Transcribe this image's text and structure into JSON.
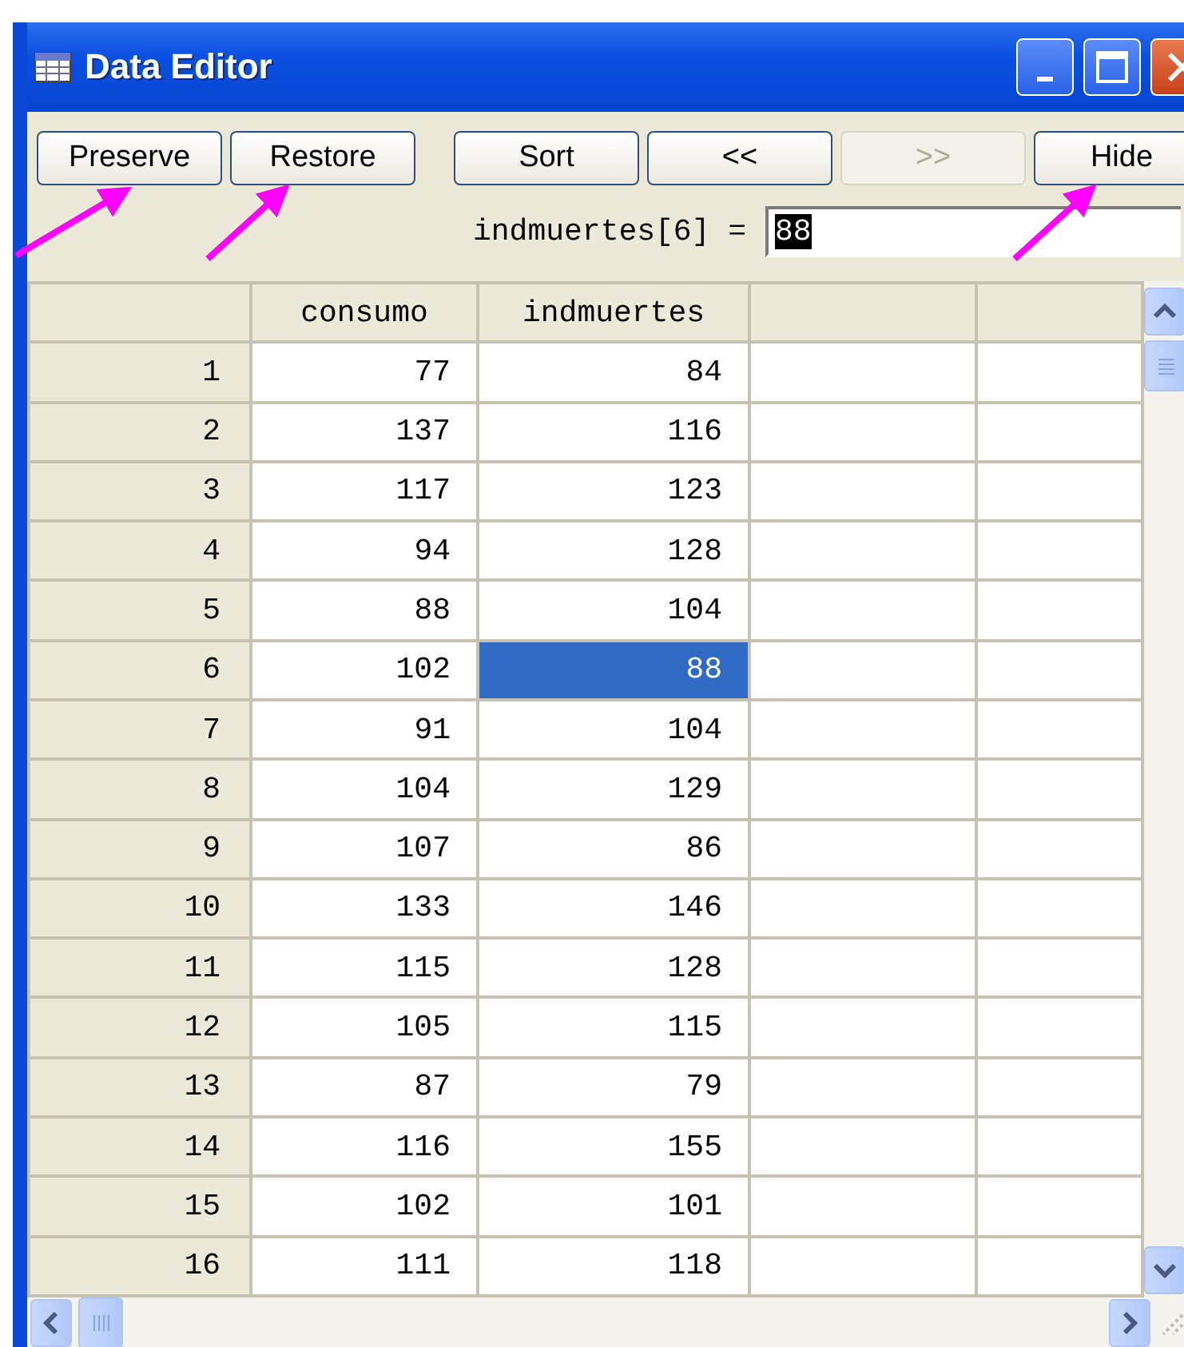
{
  "window": {
    "title": "Data Editor"
  },
  "toolbar": {
    "buttons": [
      {
        "label": "Preserve",
        "disabled": false
      },
      {
        "label": "Restore",
        "disabled": false
      },
      {
        "label": "Sort",
        "disabled": false
      },
      {
        "label": "<<",
        "disabled": false
      },
      {
        "label": ">>",
        "disabled": true
      },
      {
        "label": "Hide",
        "disabled": false
      }
    ]
  },
  "formula": {
    "label": "indmuertes[6] =",
    "value": "88"
  },
  "table": {
    "columns": [
      "consumo",
      "indmuertes"
    ],
    "rows": [
      {
        "number": "1",
        "cells": [
          {
            "text": "77",
            "selected": false
          },
          {
            "text": "84",
            "selected": false
          }
        ]
      },
      {
        "number": "2",
        "cells": [
          {
            "text": "137",
            "selected": false
          },
          {
            "text": "116",
            "selected": false
          }
        ]
      },
      {
        "number": "3",
        "cells": [
          {
            "text": "117",
            "selected": false
          },
          {
            "text": "123",
            "selected": false
          }
        ]
      },
      {
        "number": "4",
        "cells": [
          {
            "text": "94",
            "selected": false
          },
          {
            "text": "128",
            "selected": false
          }
        ]
      },
      {
        "number": "5",
        "cells": [
          {
            "text": "88",
            "selected": false
          },
          {
            "text": "104",
            "selected": false
          }
        ]
      },
      {
        "number": "6",
        "cells": [
          {
            "text": "102",
            "selected": false
          },
          {
            "text": "88",
            "selected": true
          }
        ]
      },
      {
        "number": "7",
        "cells": [
          {
            "text": "91",
            "selected": false
          },
          {
            "text": "104",
            "selected": false
          }
        ]
      },
      {
        "number": "8",
        "cells": [
          {
            "text": "104",
            "selected": false
          },
          {
            "text": "129",
            "selected": false
          }
        ]
      },
      {
        "number": "9",
        "cells": [
          {
            "text": "107",
            "selected": false
          },
          {
            "text": "86",
            "selected": false
          }
        ]
      },
      {
        "number": "10",
        "cells": [
          {
            "text": "133",
            "selected": false
          },
          {
            "text": "146",
            "selected": false
          }
        ]
      },
      {
        "number": "11",
        "cells": [
          {
            "text": "115",
            "selected": false
          },
          {
            "text": "128",
            "selected": false
          }
        ]
      },
      {
        "number": "12",
        "cells": [
          {
            "text": "105",
            "selected": false
          },
          {
            "text": "115",
            "selected": false
          }
        ]
      },
      {
        "number": "13",
        "cells": [
          {
            "text": "87",
            "selected": false
          },
          {
            "text": "79",
            "selected": false
          }
        ]
      },
      {
        "number": "14",
        "cells": [
          {
            "text": "116",
            "selected": false
          },
          {
            "text": "155",
            "selected": false
          }
        ]
      },
      {
        "number": "15",
        "cells": [
          {
            "text": "102",
            "selected": false
          },
          {
            "text": "101",
            "selected": false
          }
        ]
      },
      {
        "number": "16",
        "cells": [
          {
            "text": "111",
            "selected": false
          },
          {
            "text": "118",
            "selected": false
          }
        ]
      }
    ]
  }
}
